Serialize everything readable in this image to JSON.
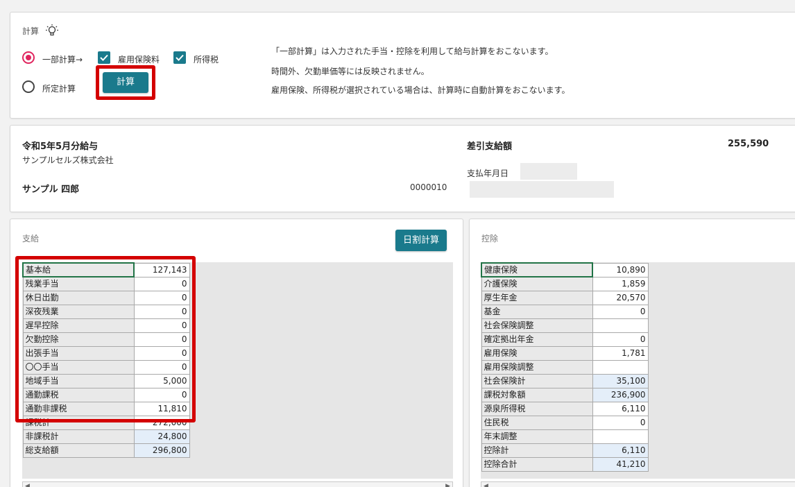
{
  "calc": {
    "title": "計算",
    "radio_partial": "一部計算→",
    "radio_fixed": "所定計算",
    "check_employment_insurance": "雇用保険料",
    "check_income_tax": "所得税",
    "calc_button": "計算",
    "info": [
      "「一部計算」は入力された手当・控除を利用して給与計算をおこないます。",
      "時間外、欠勤単価等には反映されません。",
      "雇用保険、所得税が選択されている場合は、計算時に自動計算をおこないます。"
    ]
  },
  "header": {
    "period": "令和5年5月分給与",
    "company": "サンプルセルズ株式会社",
    "employee_name": "サンプル 四郎",
    "employee_code": "0000010",
    "net_pay_label": "差引支給額",
    "net_pay_value": "255,590",
    "paydate_label": "支払年月日"
  },
  "pay": {
    "title": "支給",
    "prorate_button": "日割計算",
    "rows": [
      {
        "label": "基本給",
        "value": "127,143"
      },
      {
        "label": "残業手当",
        "value": "0"
      },
      {
        "label": "休日出勤",
        "value": "0"
      },
      {
        "label": "深夜残業",
        "value": "0"
      },
      {
        "label": "遅早控除",
        "value": "0"
      },
      {
        "label": "欠勤控除",
        "value": "0"
      },
      {
        "label": "出張手当",
        "value": "0"
      },
      {
        "label": "〇〇手当",
        "value": "0"
      },
      {
        "label": "地域手当",
        "value": "5,000"
      },
      {
        "label": "通勤課税",
        "value": "0"
      },
      {
        "label": "通勤非課税",
        "value": "11,810"
      },
      {
        "label": "課税計",
        "value": "272,000"
      },
      {
        "label": "非課税計",
        "value": "24,800"
      },
      {
        "label": "総支給額",
        "value": "296,800"
      }
    ]
  },
  "deduction": {
    "title": "控除",
    "rows": [
      {
        "label": "健康保険",
        "value": "10,890"
      },
      {
        "label": "介護保険",
        "value": "1,859"
      },
      {
        "label": "厚生年金",
        "value": "20,570"
      },
      {
        "label": "基金",
        "value": "0"
      },
      {
        "label": "社会保険調整",
        "value": ""
      },
      {
        "label": "確定拠出年金",
        "value": "0"
      },
      {
        "label": "雇用保険",
        "value": "1,781"
      },
      {
        "label": "雇用保険調整",
        "value": ""
      },
      {
        "label": "社会保険計",
        "value": "35,100"
      },
      {
        "label": "課税対象額",
        "value": "236,900"
      },
      {
        "label": "源泉所得税",
        "value": "6,110"
      },
      {
        "label": "住民税",
        "value": "0"
      },
      {
        "label": "年末調整",
        "value": ""
      },
      {
        "label": "控除計",
        "value": "6,110"
      },
      {
        "label": "控除合計",
        "value": "41,210"
      }
    ]
  },
  "colors": {
    "teal": "#1a7a8c",
    "radio_selected": "#e0245e",
    "highlight": "#d40000",
    "sum_cell": "#e4eef9"
  }
}
